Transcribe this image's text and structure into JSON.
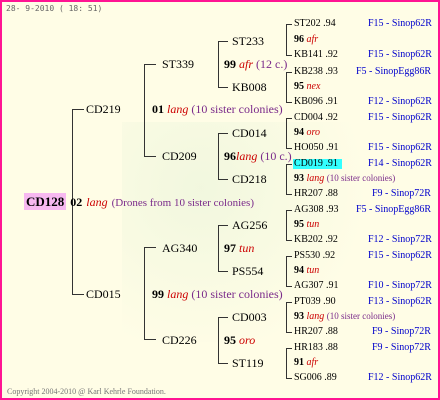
{
  "header": "28- 9-2010 ( 18: 51)",
  "footer": "Copyright 2004-2010 @ Karl Kehrle Foundation.",
  "root": {
    "name": "CD128",
    "num": "02",
    "species": "lang",
    "comment": "(Drones from 10 sister colonies)"
  },
  "g1": [
    {
      "name": "CD219",
      "num": "01",
      "species": "lang",
      "comment": "(10 sister colonies)"
    },
    {
      "name": "CD015",
      "num": "99",
      "species": "lang",
      "comment": "(10 sister colonies)"
    }
  ],
  "g2": [
    {
      "name": "ST339",
      "num": "99",
      "species": "afr",
      "comment": "(12 c.)"
    },
    {
      "name": "CD209",
      "num": "96",
      "species": "lang",
      "comment": "(10 c.)"
    },
    {
      "name": "AG340",
      "num": "97",
      "species": "tun",
      "comment": ""
    },
    {
      "name": "CD226",
      "num": "95",
      "species": "oro",
      "comment": ""
    }
  ],
  "g3": [
    {
      "name": "ST233",
      "num": "96",
      "species": "afr",
      "comment": ""
    },
    {
      "name": "KB008",
      "num": "95",
      "species": "nex",
      "comment": ""
    },
    {
      "name": "CD014",
      "num": "94",
      "species": "oro",
      "comment": ""
    },
    {
      "name": "CD218",
      "num": "93",
      "species": "lang",
      "comment": "(10 sister colonies)"
    },
    {
      "name": "AG256",
      "num": "95",
      "species": "tun",
      "comment": ""
    },
    {
      "name": "PS554",
      "num": "94",
      "species": "tun",
      "comment": ""
    },
    {
      "name": "CD003",
      "num": "93",
      "species": "lang",
      "comment": "(10 sister colonies)"
    },
    {
      "name": "ST119",
      "num": "91",
      "species": "afr",
      "comment": ""
    }
  ],
  "g4": [
    {
      "name": "ST202",
      "val": ".94",
      "src": "F15 - Sinop62R"
    },
    {
      "name": "KB141",
      "val": ".92",
      "src": "F15 - Sinop62R"
    },
    {
      "name": "KB238",
      "val": ".93",
      "src": "F5 - SinopEgg86R"
    },
    {
      "name": "KB096",
      "val": ".91",
      "src": "F12 - Sinop62R"
    },
    {
      "name": "CD004",
      "val": ".92",
      "src": "F15 - Sinop62R"
    },
    {
      "name": "HO050",
      "val": ".91",
      "src": "F15 - Sinop62R"
    },
    {
      "name": "CD019",
      "val": ".91",
      "src": "F14 - Sinop62R"
    },
    {
      "name": "HR207",
      "val": ".88",
      "src": "F9 - Sinop72R"
    },
    {
      "name": "AG308",
      "val": ".93",
      "src": "F5 - SinopEgg86R"
    },
    {
      "name": "KB202",
      "val": ".92",
      "src": "F12 - Sinop72R"
    },
    {
      "name": "PS530",
      "val": ".92",
      "src": "F15 - Sinop62R"
    },
    {
      "name": "AG307",
      "val": ".91",
      "src": "F10 - Sinop72R"
    },
    {
      "name": "PT039",
      "val": ".90",
      "src": "F13 - Sinop62R"
    },
    {
      "name": "HR207",
      "val": ".88",
      "src": "F9 - Sinop72R"
    },
    {
      "name": "HR183",
      "val": ".88",
      "src": "F9 - Sinop72R"
    },
    {
      "name": "SG006",
      "val": ".89",
      "src": "F12 - Sinop62R"
    }
  ]
}
